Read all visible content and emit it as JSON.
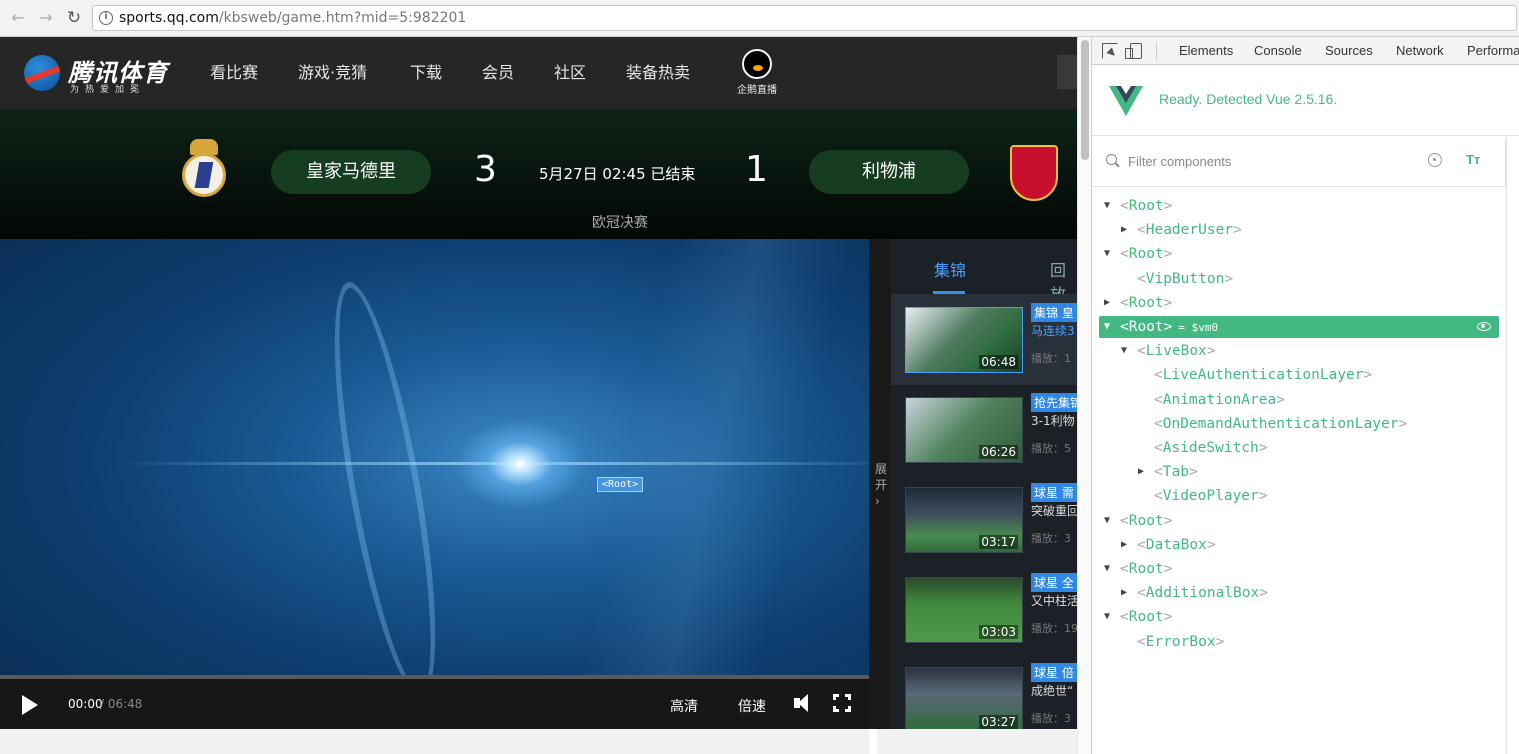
{
  "browser": {
    "url_host": "sports.qq.com",
    "url_path": "/kbsweb/game.htm?mid=5:982201",
    "back_icon": "back-arrow-icon",
    "forward_icon": "forward-arrow-icon",
    "reload_icon": "reload-icon"
  },
  "site": {
    "logo_name": "腾讯体育",
    "logo_slogan": "为热爱加冕",
    "nav": [
      "看比赛",
      "游戏·竞猜",
      "下载",
      "会员",
      "社区",
      "装备热卖"
    ],
    "live_label": "企鹅直播"
  },
  "match": {
    "home_team": "皇家马德里",
    "home_score": "3",
    "away_team": "利物浦",
    "away_score": "1",
    "status": "5月27日 02:45 已结束",
    "competition": "欧冠决赛"
  },
  "player": {
    "overlay_tag": "<Root>",
    "current_time": "00:00",
    "total_time": "/ 06:48",
    "quality_label": "高清",
    "speed_label": "倍速"
  },
  "sidebar": {
    "expand_label": "展开 ›",
    "tabs": [
      "集锦",
      "回放"
    ],
    "videos": [
      {
        "badge": "集锦 皇",
        "text": "马连续3",
        "plays": "播放：1",
        "duration": "06:48"
      },
      {
        "badge": "抢先集锦",
        "text": "3-1利物",
        "plays": "播放：5",
        "duration": "06:26"
      },
      {
        "badge": "球星 需",
        "text": "突破重回",
        "plays": "播放：3",
        "duration": "03:17"
      },
      {
        "badge": "球星 全",
        "text": "又中柱活",
        "plays": "播放：19",
        "duration": "03:03"
      },
      {
        "badge": "球星 倍",
        "text": "成绝世“",
        "plays": "播放：3",
        "duration": "03:27"
      }
    ]
  },
  "devtools": {
    "tabs": [
      "Elements",
      "Console",
      "Sources",
      "Network",
      "Performa"
    ],
    "vue_status": "Ready. Detected Vue 2.5.16.",
    "filter_placeholder": "Filter components",
    "tt_label": "Tт",
    "tree": [
      {
        "name": "Root",
        "depth": 0,
        "arrow": "down"
      },
      {
        "name": "HeaderUser",
        "depth": 1,
        "arrow": "right"
      },
      {
        "name": "Root",
        "depth": 0,
        "arrow": "down"
      },
      {
        "name": "VipButton",
        "depth": 1,
        "arrow": ""
      },
      {
        "name": "Root",
        "depth": 0,
        "arrow": "right"
      },
      {
        "name": "Root",
        "depth": 0,
        "arrow": "down",
        "selected": true,
        "vm": "= $vm0"
      },
      {
        "name": "LiveBox",
        "depth": 1,
        "arrow": "down"
      },
      {
        "name": "LiveAuthenticationLayer",
        "depth": 2,
        "arrow": ""
      },
      {
        "name": "AnimationArea",
        "depth": 2,
        "arrow": ""
      },
      {
        "name": "OnDemandAuthenticationLayer",
        "depth": 2,
        "arrow": ""
      },
      {
        "name": "AsideSwitch",
        "depth": 2,
        "arrow": ""
      },
      {
        "name": "Tab",
        "depth": 2,
        "arrow": "right"
      },
      {
        "name": "VideoPlayer",
        "depth": 2,
        "arrow": ""
      },
      {
        "name": "Root",
        "depth": 0,
        "arrow": "down"
      },
      {
        "name": "DataBox",
        "depth": 1,
        "arrow": "right"
      },
      {
        "name": "Root",
        "depth": 0,
        "arrow": "down"
      },
      {
        "name": "AdditionalBox",
        "depth": 1,
        "arrow": "right"
      },
      {
        "name": "Root",
        "depth": 0,
        "arrow": "down"
      },
      {
        "name": "ErrorBox",
        "depth": 1,
        "arrow": ""
      }
    ]
  },
  "colors": {
    "vue_green": "#42b883",
    "accent_blue": "#2f87e6"
  }
}
